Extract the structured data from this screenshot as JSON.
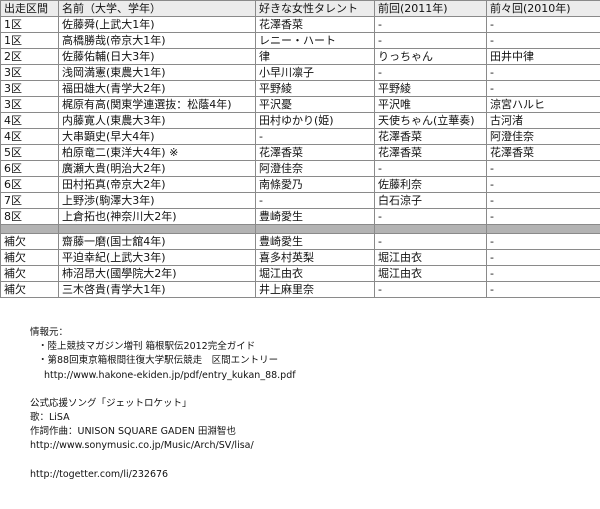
{
  "table": {
    "headers": [
      "出走区間",
      "名前（大学、学年）",
      "好きな女性タレント",
      "前回(2011年)",
      "前々回(2010年)"
    ],
    "rows": [
      [
        "1区",
        "佐藤舜(上武大1年)",
        "花澤香菜",
        "-",
        "-"
      ],
      [
        "1区",
        "高橋勝哉(帝京大1年)",
        "レニー・ハート",
        "-",
        "-"
      ],
      [
        "2区",
        "佐藤佑輔(日大3年)",
        "律",
        "りっちゃん",
        "田井中律"
      ],
      [
        "3区",
        "浅岡満憲(東農大1年)",
        "小早川凛子",
        "-",
        "-"
      ],
      [
        "3区",
        "福田雄大(青学大2年)",
        "平野綾",
        "平野綾",
        "-"
      ],
      [
        "3区",
        "梶原有高(関東学連選抜：松蔭4年)",
        "平沢憂",
        "平沢唯",
        "涼宮ハルヒ"
      ],
      [
        "4区",
        "内藤寛人(東農大3年)",
        "田村ゆかり(姫)",
        "天使ちゃん(立華奏)",
        "古河渚"
      ],
      [
        "4区",
        "大串顕史(早大4年)",
        "-",
        "花澤香菜",
        "阿澄佳奈"
      ],
      [
        "5区",
        "柏原竜二(東洋大4年) ※",
        "花澤香菜",
        "花澤香菜",
        "花澤香菜"
      ],
      [
        "6区",
        "廣瀬大貴(明治大2年)",
        "阿澄佳奈",
        "-",
        "-"
      ],
      [
        "6区",
        "田村拓真(帝京大2年)",
        "南條愛乃",
        "佐藤利奈",
        "-"
      ],
      [
        "7区",
        "上野渉(駒澤大3年)",
        "-",
        "白石涼子",
        "-"
      ],
      [
        "8区",
        "上倉拓也(神奈川大2年)",
        "豊崎愛生",
        "-",
        "-"
      ]
    ],
    "reserves": [
      [
        "補欠",
        "齋藤一磨(国士舘4年)",
        "豊崎愛生",
        "-",
        "-"
      ],
      [
        "補欠",
        "平迫幸紀(上武大3年)",
        "喜多村英梨",
        "堀江由衣",
        "-"
      ],
      [
        "補欠",
        "柿沼昂大(國學院大2年)",
        "堀江由衣",
        "堀江由衣",
        "-"
      ],
      [
        "補欠",
        "三木啓貴(青学大1年)",
        "井上麻里奈",
        "-",
        "-"
      ]
    ]
  },
  "notes": {
    "source_heading": "情報元：",
    "source_1": "・陸上競技マガジン増刊 箱根駅伝2012完全ガイド",
    "source_2": "・第88回東京箱根間往復大学駅伝競走　区間エントリー",
    "source_2_url": "http://www.hakone-ekiden.jp/pdf/entry_kukan_88.pdf",
    "song_heading": "公式応援ソング「ジェットロケット」",
    "singer": "歌：LiSA",
    "composer": "作詞作曲：UNISON SQUARE GADEN 田淵智也",
    "song_url": "http://www.sonymusic.co.jp/Music/Arch/SV/lisa/",
    "togetter_url": "http://togetter.com/li/232676"
  }
}
